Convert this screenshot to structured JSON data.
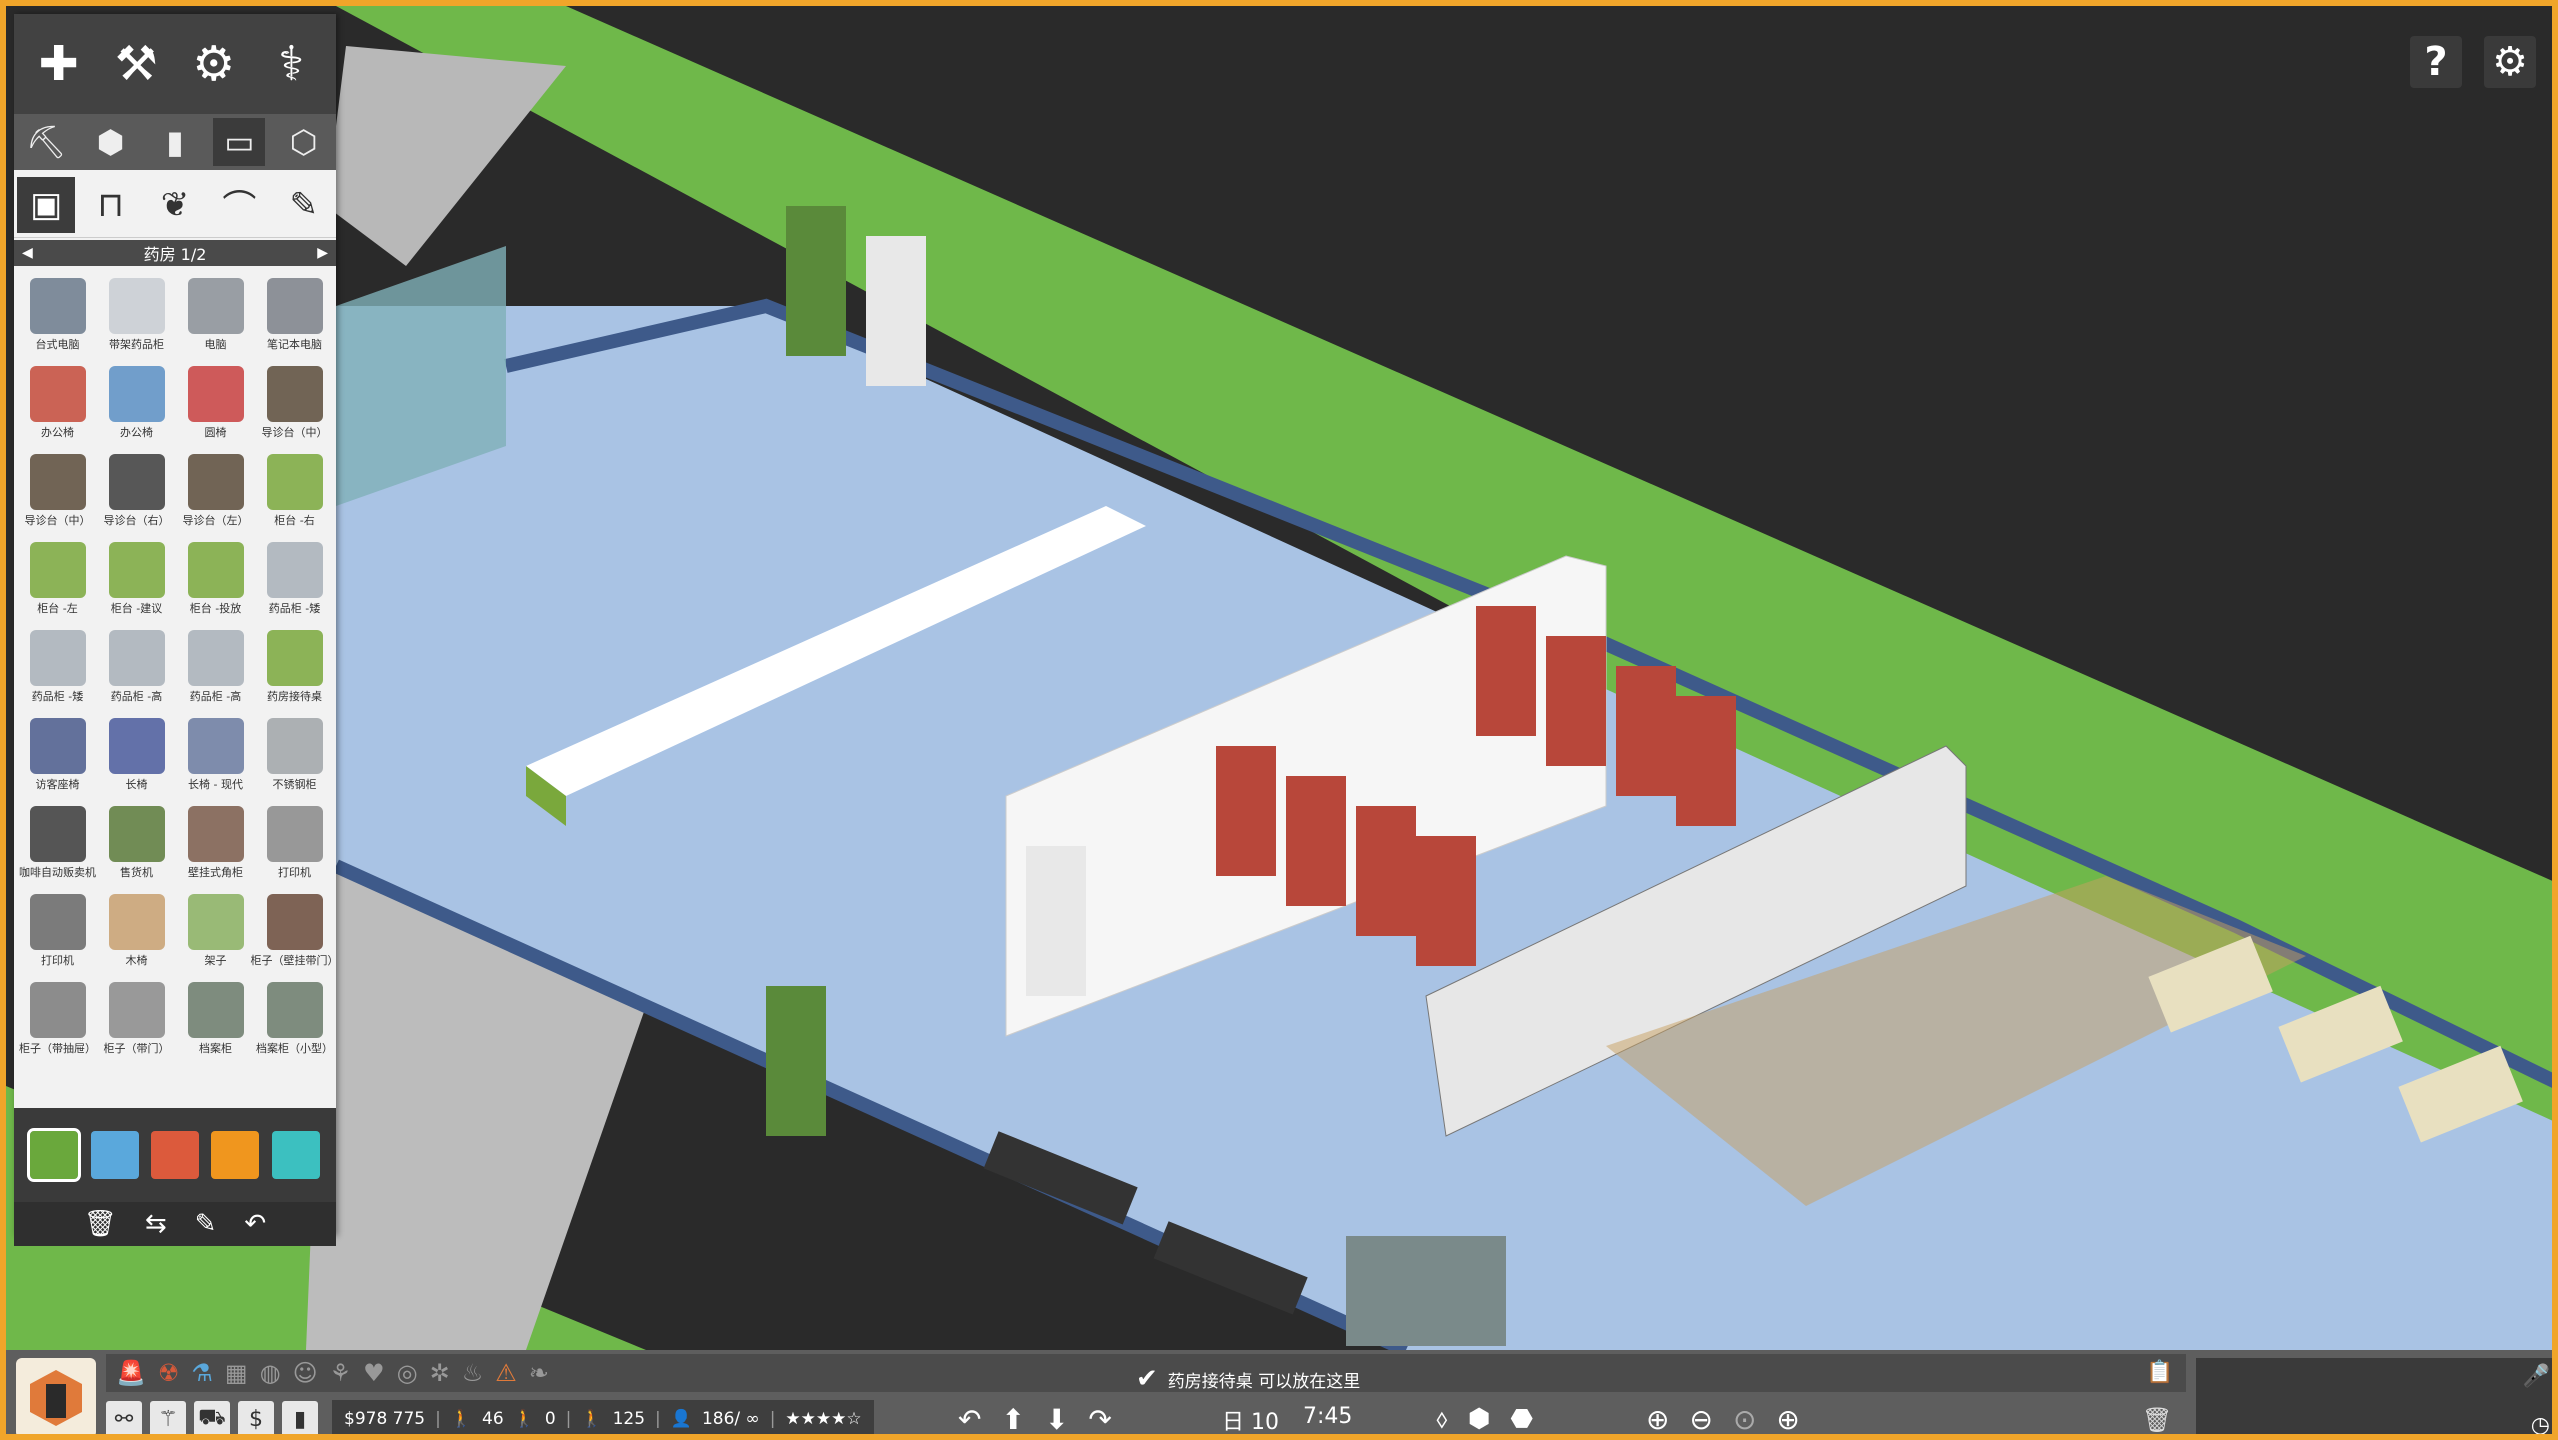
{
  "left_panel": {
    "top_buttons": [
      {
        "name": "build-plus",
        "glyph": "✚"
      },
      {
        "name": "hammer",
        "glyph": "⚒"
      },
      {
        "name": "gears",
        "glyph": "⚙"
      },
      {
        "name": "stethoscope",
        "glyph": "⚕"
      }
    ],
    "categories": [
      {
        "name": "crane",
        "glyph": "⛏"
      },
      {
        "name": "cube",
        "glyph": "⬢"
      },
      {
        "name": "wall-door",
        "glyph": "▮"
      },
      {
        "name": "monitor",
        "glyph": "▭"
      },
      {
        "name": "boxes",
        "glyph": "⬡"
      }
    ],
    "subcategories": [
      {
        "name": "equipment",
        "glyph": "▣"
      },
      {
        "name": "desk",
        "glyph": "⊓"
      },
      {
        "name": "plant",
        "glyph": "❦"
      },
      {
        "name": "lamp",
        "glyph": "⌒"
      },
      {
        "name": "paint",
        "glyph": "✎"
      }
    ],
    "page_label": "药房 1/2",
    "items": [
      {
        "label": "台式电脑",
        "color": "#6b7a8c"
      },
      {
        "label": "带架药品柜",
        "color": "#c8ccd2"
      },
      {
        "label": "电脑",
        "color": "#8a8f96"
      },
      {
        "label": "笔记本电脑",
        "color": "#7b8088"
      },
      {
        "label": "办公椅",
        "color": "#c44a3a"
      },
      {
        "label": "办公椅",
        "color": "#5b8fc4"
      },
      {
        "label": "圆椅",
        "color": "#c84040"
      },
      {
        "label": "导诊台（中）",
        "color": "#5b4b3a"
      },
      {
        "label": "导诊台（中）",
        "color": "#5b4b3a"
      },
      {
        "label": "导诊台（右）",
        "color": "#3c3c3c"
      },
      {
        "label": "导诊台（左）",
        "color": "#5b4b3a"
      },
      {
        "label": "柜台 -右",
        "color": "#7aa83c"
      },
      {
        "label": "柜台 -左",
        "color": "#7aa83c"
      },
      {
        "label": "柜台 -建议",
        "color": "#7aa83c"
      },
      {
        "label": "柜台 -投放",
        "color": "#7aa83c"
      },
      {
        "label": "药品柜 -矮",
        "color": "#a8b0b8"
      },
      {
        "label": "药品柜 -矮",
        "color": "#a8b0b8"
      },
      {
        "label": "药品柜 -高",
        "color": "#a8b0b8"
      },
      {
        "label": "药品柜 -高",
        "color": "#a8b0b8"
      },
      {
        "label": "药房接待桌",
        "color": "#7aa83c"
      },
      {
        "label": "访客座椅",
        "color": "#4a5a8c"
      },
      {
        "label": "长椅",
        "color": "#4a5a9c"
      },
      {
        "label": "长椅 - 现代",
        "color": "#6a7aa0"
      },
      {
        "label": "不锈钢柜",
        "color": "#a0a4a8"
      },
      {
        "label": "咖啡自动贩卖机",
        "color": "#3a3a3a"
      },
      {
        "label": "售货机",
        "color": "#5a7a3a"
      },
      {
        "label": "壁挂式角柜",
        "color": "#7a5a4a"
      },
      {
        "label": "打印机",
        "color": "#888888"
      },
      {
        "label": "打印机",
        "color": "#666666"
      },
      {
        "label": "木椅",
        "color": "#c8a070"
      },
      {
        "label": "架子",
        "color": "#8ab060"
      },
      {
        "label": "柜子（壁挂带门）",
        "color": "#6a4a3a"
      },
      {
        "label": "柜子（带抽屉）",
        "color": "#7a7a7a"
      },
      {
        "label": "柜子（带门）",
        "color": "#8a8a8a"
      },
      {
        "label": "档案柜",
        "color": "#6a7a6a"
      },
      {
        "label": "档案柜（小型）",
        "color": "#6a7a6a"
      }
    ],
    "swatches": [
      "#6aa83c",
      "#5aa8dc",
      "#dc5a3c",
      "#f0961e",
      "#3cc0c0"
    ],
    "tools": [
      {
        "name": "trash",
        "glyph": "🗑"
      },
      {
        "name": "move",
        "glyph": "⇆"
      },
      {
        "name": "eyedropper",
        "glyph": "✎"
      },
      {
        "name": "undo",
        "glyph": "↶"
      }
    ]
  },
  "top_right": {
    "help": "?",
    "settings": "⚙"
  },
  "bottom_bar": {
    "status_message": "药房接待桌 可以放在这里",
    "money": "$978 775",
    "staff_count": "46",
    "sick_count": "0",
    "visitors": "125",
    "capacity": "186/ ∞",
    "rating": "★★★★☆",
    "day_label": "日 10",
    "time": "7:45"
  },
  "colors": {
    "frame_border": "#f0a52a",
    "grass": "#6fb84a",
    "floor": "#a9c3e4",
    "wall_trim": "#3e5a8a",
    "sky": "#2a2a2a"
  }
}
